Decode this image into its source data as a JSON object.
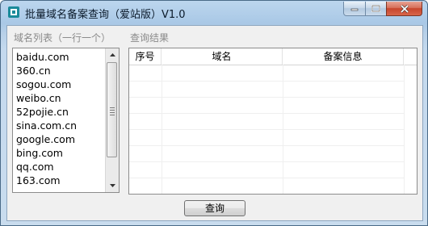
{
  "window": {
    "title": "批量域名备案查询（爱站版）V1.0",
    "icon": "app-icon"
  },
  "labels": {
    "domain_list": "域名列表（一行一个）",
    "results": "查询结果"
  },
  "domains": [
    "baidu.com",
    "360.cn",
    "sogou.com",
    "weibo.cn",
    "52pojie.cn",
    "sina.com.cn",
    "google.com",
    "bing.com",
    "qq.com",
    "163.com"
  ],
  "table": {
    "columns": [
      "序号",
      "域名",
      "备案信息"
    ],
    "rows": []
  },
  "buttons": {
    "query": "查询"
  }
}
